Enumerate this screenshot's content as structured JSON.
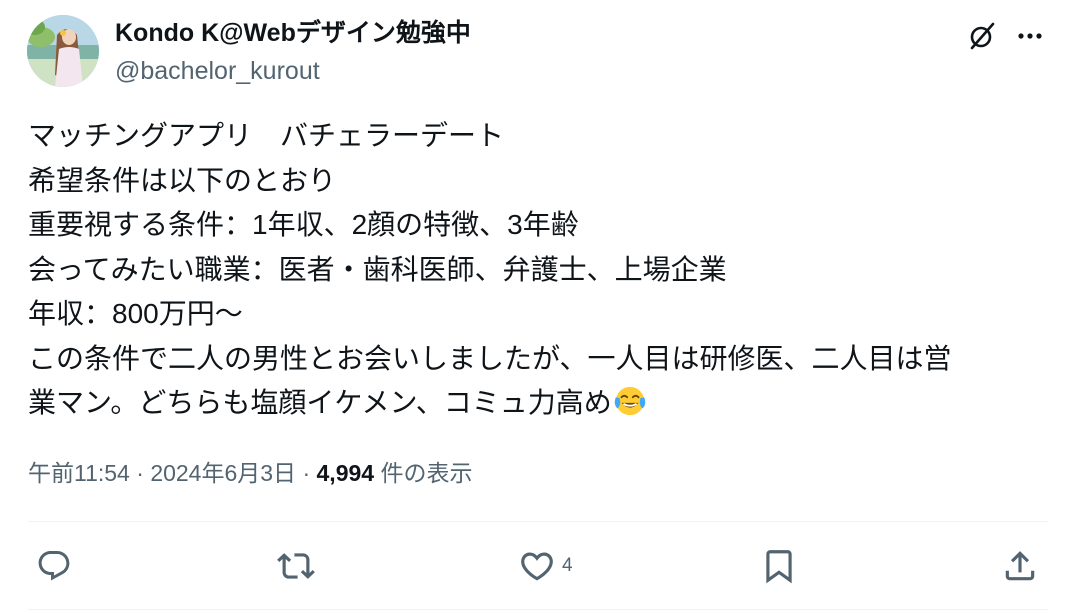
{
  "author": {
    "display_name": "Kondo K@Webデザイン勉強中",
    "handle": "@bachelor_kurout"
  },
  "header_icons": {
    "grok": "grok-slash-icon",
    "more": "more-dots-icon"
  },
  "tweet": {
    "lines": [
      "マッチングアプリ　バチェラーデート",
      "希望条件は以下のとおり",
      "重要視する条件：1年収、2顔の特徴、3年齢",
      "会ってみたい職業：医者・歯科医師、弁護士、上場企業",
      "年収：800万円〜",
      "この条件で二人の男性とお会いしましたが、一人目は研修医、二人目は営",
      "業マン。どちらも塩顔イケメン、コミュ力高め"
    ],
    "emoji": "face-with-tears-of-joy"
  },
  "meta": {
    "time": "午前11:54",
    "separator": " · ",
    "date": "2024年6月3日",
    "views_count": "4,994",
    "views_label": " 件の表示"
  },
  "actions": {
    "reply": {
      "icon": "reply-icon",
      "count": ""
    },
    "retweet": {
      "icon": "retweet-icon",
      "count": ""
    },
    "like": {
      "icon": "heart-icon",
      "count": "4"
    },
    "bookmark": {
      "icon": "bookmark-icon"
    },
    "share": {
      "icon": "share-icon"
    }
  },
  "colors": {
    "text_primary": "#0f1419",
    "text_secondary": "#536471",
    "divider": "#eff3f4",
    "emoji_face": "#ffcc33",
    "emoji_tears": "#3fa9f5"
  }
}
